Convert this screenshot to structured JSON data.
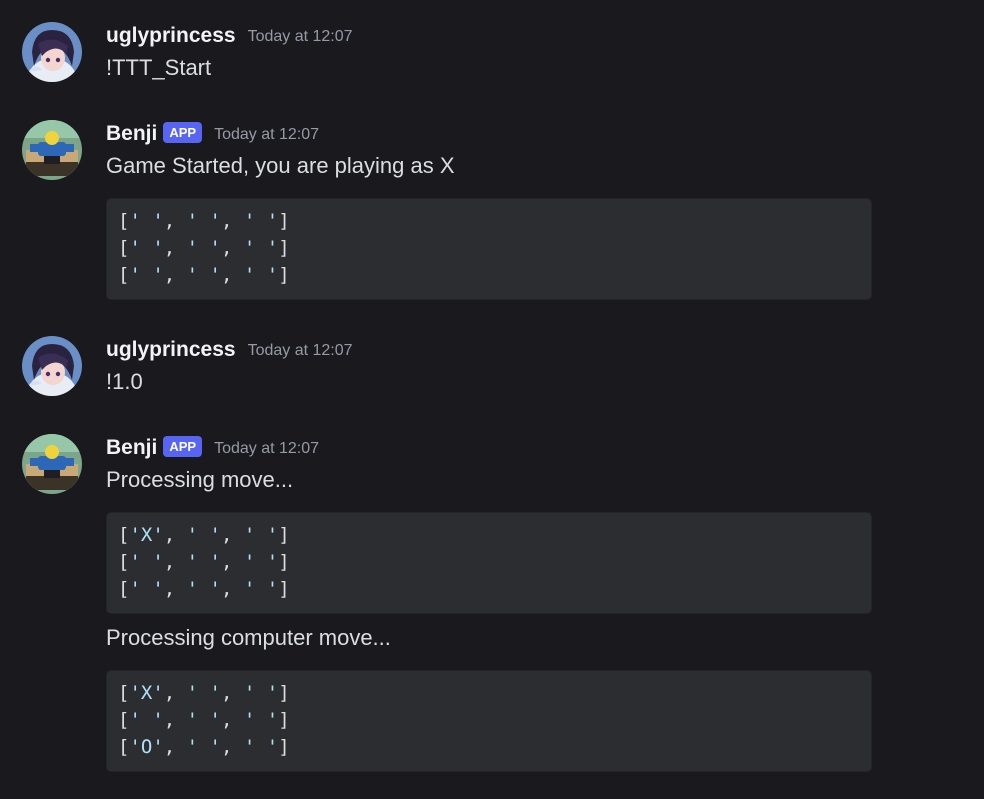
{
  "messages": [
    {
      "id": "msg1",
      "author": "uglyprincess",
      "is_app": false,
      "avatar_icon": "ugly-princess-avatar-icon",
      "timestamp": "Today at 12:07",
      "content": [
        "!TTT_Start"
      ]
    },
    {
      "id": "msg2",
      "author": "Benji",
      "is_app": true,
      "badge": "APP",
      "avatar_icon": "benji-avatar-icon",
      "timestamp": "Today at 12:07",
      "content": [
        "Game Started, you are playing as X"
      ],
      "code_blocks": [
        [
          "[' ', ' ', ' ']",
          "[' ', ' ', ' ']",
          "[' ', ' ', ' ']"
        ]
      ]
    },
    {
      "id": "msg3",
      "author": "uglyprincess",
      "is_app": false,
      "avatar_icon": "ugly-princess-avatar-icon",
      "timestamp": "Today at 12:07",
      "content": [
        "!1.0"
      ]
    },
    {
      "id": "msg4",
      "author": "Benji",
      "is_app": true,
      "badge": "APP",
      "avatar_icon": "benji-avatar-icon",
      "timestamp": "Today at 12:07",
      "content": [
        "Processing move...",
        "Processing computer move..."
      ],
      "code_blocks": [
        [
          "['X', ' ', ' ']",
          "[' ', ' ', ' ']",
          "[' ', ' ', ' ']"
        ],
        [
          "['X', ' ', ' ']",
          "[' ', ' ', ' ']",
          "['O', ' ', ' ']"
        ]
      ]
    }
  ],
  "colors": {
    "background": "#1a1a1e",
    "codeblock_bg": "#2b2d31",
    "app_badge": "#5865f2",
    "timestamp": "#949ba4",
    "string_token": "#aee1f7"
  }
}
